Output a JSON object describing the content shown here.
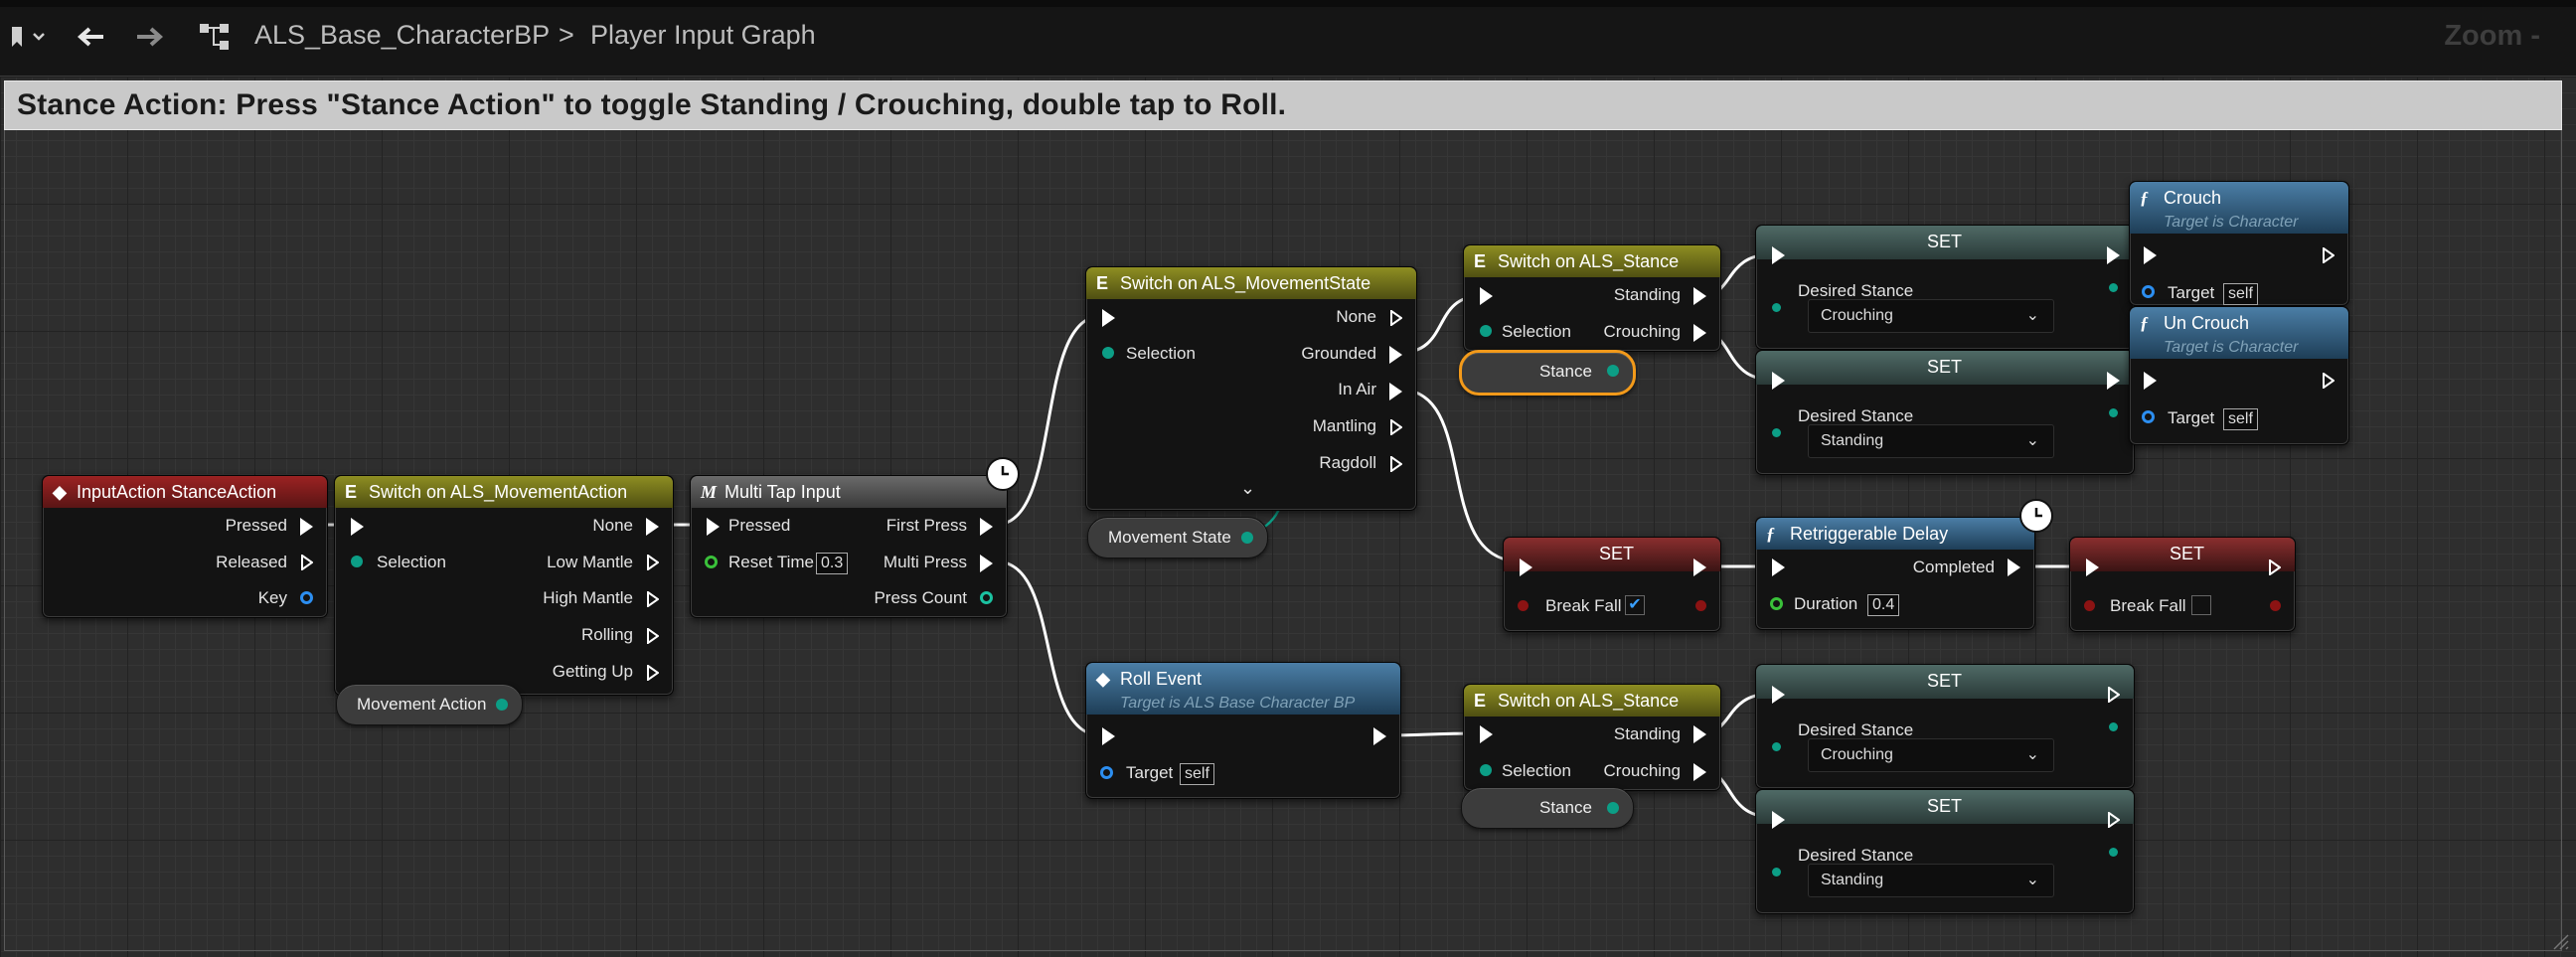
{
  "toolbar": {
    "graph_name": "ALS_Base_CharacterBP",
    "breadcrumb_sep": ">",
    "graph_title": "Player Input Graph",
    "zoom_label": "Zoom -"
  },
  "comment": {
    "text": "Stance Action: Press \"Stance Action\" to toggle Standing / Crouching, double tap to Roll."
  },
  "nodes": {
    "input_action": {
      "title": "InputAction StanceAction",
      "pins": [
        "Pressed",
        "Released",
        "Key"
      ]
    },
    "switch_movement_action": {
      "title": "Switch on ALS_MovementAction",
      "selection": "Selection",
      "outputs": [
        "None",
        "Low Mantle",
        "High Mantle",
        "Rolling",
        "Getting Up"
      ]
    },
    "movement_action_var": {
      "label": "Movement Action"
    },
    "multi_tap": {
      "title": "Multi Tap Input",
      "inputs": [
        "Pressed",
        "Reset Time"
      ],
      "reset_time": "0.3",
      "outputs": [
        "First Press",
        "Multi Press",
        "Press Count"
      ]
    },
    "switch_movement_state": {
      "title": "Switch on ALS_MovementState",
      "selection": "Selection",
      "outputs": [
        "None",
        "Grounded",
        "In Air",
        "Mantling",
        "Ragdoll"
      ],
      "expand": "⌄"
    },
    "movement_state_var": {
      "label": "Movement State"
    },
    "switch_stance_top": {
      "title": "Switch on ALS_Stance",
      "selection": "Selection",
      "outputs": [
        "Standing",
        "Crouching"
      ]
    },
    "stance_var_top": {
      "label": "Stance"
    },
    "set_crouching_top": {
      "title": "SET",
      "field": "Desired Stance",
      "value": "Crouching"
    },
    "set_standing_top": {
      "title": "SET",
      "field": "Desired Stance",
      "value": "Standing"
    },
    "crouch": {
      "title": "Crouch",
      "subtitle": "Target is Character",
      "target": "Target",
      "target_value": "self"
    },
    "uncrouch": {
      "title": "Un Crouch",
      "subtitle": "Target is Character",
      "target": "Target",
      "target_value": "self"
    },
    "set_breakfall_true": {
      "title": "SET",
      "field": "Break Fall"
    },
    "retrig_delay": {
      "title": "Retriggerable Delay",
      "completed": "Completed",
      "duration": "Duration",
      "duration_value": "0.4"
    },
    "set_breakfall_false": {
      "title": "SET",
      "field": "Break Fall"
    },
    "roll_event": {
      "title": "Roll Event",
      "subtitle": "Target is ALS Base Character BP",
      "target": "Target",
      "target_value": "self"
    },
    "switch_stance_bottom": {
      "title": "Switch on ALS_Stance",
      "selection": "Selection",
      "outputs": [
        "Standing",
        "Crouching"
      ]
    },
    "stance_var_bottom": {
      "label": "Stance"
    },
    "set_crouching_bottom": {
      "title": "SET",
      "field": "Desired Stance",
      "value": "Crouching"
    },
    "set_standing_bottom": {
      "title": "SET",
      "field": "Desired Stance",
      "value": "Standing"
    }
  },
  "colors": {
    "event_header": "#8c1e1e",
    "switch_header": "#7d7d1c",
    "macro_header": "#5a5a5a",
    "function_header": "#3f6a8c",
    "set_header": "#4b5a5a",
    "set_red_header": "#7a2a2a",
    "exec": "#ffffff",
    "enum_pin": "#0c9e86",
    "bool_pin": "#8c1313",
    "float_pin": "#3ac13a",
    "object_pin": "#2c8ef0",
    "selected_outline": "#f39a1a"
  },
  "icons": {
    "bookmark": "bookmark-icon",
    "back": "back-arrow-icon",
    "forward": "forward-arrow-icon",
    "graph": "graph-icon",
    "function": "function-icon",
    "switch": "switch-icon",
    "event": "event-icon",
    "macro": "macro-icon",
    "clock": "latent-clock-icon"
  }
}
